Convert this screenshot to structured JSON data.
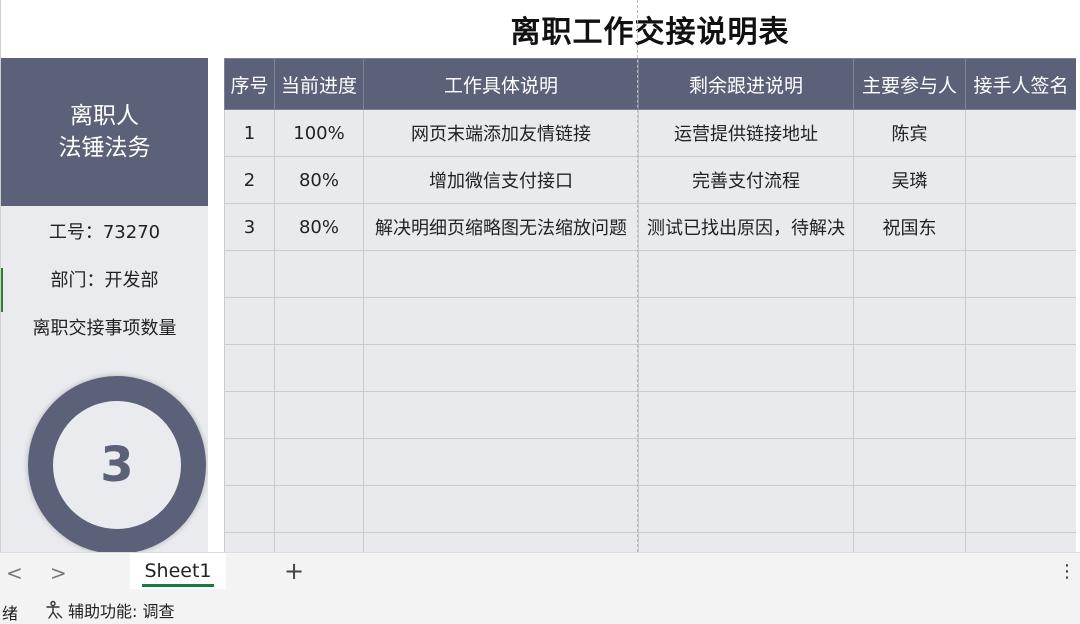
{
  "title": "离职工作交接说明表",
  "profile": {
    "heading_line1": "离职人",
    "heading_line2": "法锤法务",
    "employee_id": "工号：73270",
    "department": "部门：开发部",
    "count_label": "离职交接事项数量",
    "count_value": "3"
  },
  "table": {
    "headers": [
      "序号",
      "当前进度",
      "工作具体说明",
      "剩余跟进说明",
      "主要参与人",
      "接手人签名"
    ],
    "rows": [
      [
        "1",
        "100%",
        "网页末端添加友情链接",
        "运营提供链接地址",
        "陈宾",
        ""
      ],
      [
        "2",
        "80%",
        "增加微信支付接口",
        "完善支付流程",
        "吴璘",
        ""
      ],
      [
        "3",
        "80%",
        "解决明细页缩略图无法缩放问题",
        "测试已找出原因，待解决",
        "祝国东",
        ""
      ],
      [
        "",
        "",
        "",
        "",
        "",
        ""
      ],
      [
        "",
        "",
        "",
        "",
        "",
        ""
      ],
      [
        "",
        "",
        "",
        "",
        "",
        ""
      ],
      [
        "",
        "",
        "",
        "",
        "",
        ""
      ],
      [
        "",
        "",
        "",
        "",
        "",
        ""
      ],
      [
        "",
        "",
        "",
        "",
        "",
        ""
      ],
      [
        "",
        "",
        "",
        "",
        "",
        ""
      ]
    ]
  },
  "sheet_tabs": {
    "active": "Sheet1",
    "prev": "<",
    "next": ">",
    "add": "+",
    "more": "⋮"
  },
  "status": {
    "ready": "绪",
    "accessibility": "辅助功能: 调查"
  },
  "colors": {
    "header_bg": "#5b6178",
    "cell_bg": "#e9eaed",
    "active_tab_underline": "#107c41"
  }
}
